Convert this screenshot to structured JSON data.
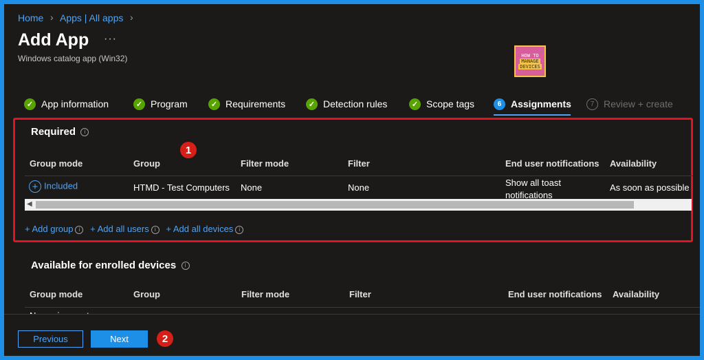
{
  "breadcrumb": {
    "home": "Home",
    "apps": "Apps | All apps"
  },
  "header": {
    "title": "Add App",
    "more": "···",
    "subtitle": "Windows catalog app (Win32)"
  },
  "logo": {
    "line1": "HOW TO",
    "line2": "MANAGE",
    "line3": "DEVICES"
  },
  "tabs": [
    {
      "label": "App information",
      "status": "done"
    },
    {
      "label": "Program",
      "status": "done"
    },
    {
      "label": "Requirements",
      "status": "done"
    },
    {
      "label": "Detection rules",
      "status": "done"
    },
    {
      "label": "Scope tags",
      "status": "done"
    },
    {
      "label": "Assignments",
      "status": "active",
      "number": "6"
    },
    {
      "label": "Review + create",
      "status": "pending",
      "number": "7"
    }
  ],
  "annotations": {
    "badge1": "1",
    "badge2": "2"
  },
  "required": {
    "title": "Required",
    "columns": [
      "Group mode",
      "Group",
      "Filter mode",
      "Filter",
      "End user notifications",
      "Availability"
    ],
    "row": {
      "group_mode": "Included",
      "group": "HTMD - Test Computers",
      "filter_mode": "None",
      "filter": "None",
      "notifications_line1": "Show all toast",
      "notifications_line2": "notifications",
      "availability": "As soon as possible"
    },
    "add_group": "+ Add group",
    "add_all_users": "+ Add all users",
    "add_all_devices": "+ Add all devices"
  },
  "available": {
    "title": "Available for enrolled devices",
    "columns": [
      "Group mode",
      "Group",
      "Filter mode",
      "Filter",
      "End user notifications",
      "Availability"
    ],
    "no_assignments": "No assignments"
  },
  "footer": {
    "previous": "Previous",
    "next": "Next"
  },
  "colors": {
    "accent": "#1e8fe6",
    "link": "#4ea3f5",
    "success": "#57a300",
    "highlight": "#e81123"
  }
}
